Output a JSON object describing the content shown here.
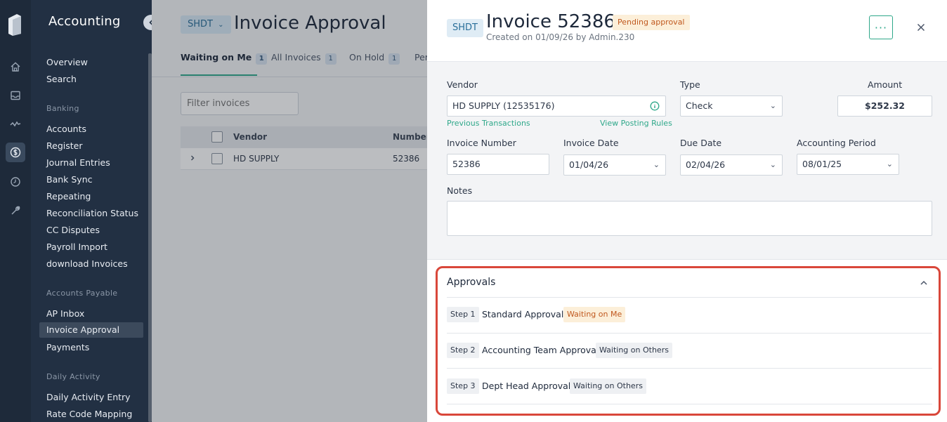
{
  "app": {
    "module_title": "Accounting"
  },
  "sidebar": {
    "items": [
      {
        "label": "Overview"
      },
      {
        "label": "Search"
      }
    ],
    "sections": [
      {
        "title": "Banking",
        "items": [
          "Accounts",
          "Register",
          "Journal Entries",
          "Bank Sync",
          "Repeating",
          "Reconciliation Status",
          "CC Disputes",
          "Payroll Import",
          "download Invoices"
        ]
      },
      {
        "title": "Accounts Payable",
        "items": [
          "AP Inbox",
          "Invoice Approval",
          "Payments"
        ]
      },
      {
        "title": "Daily Activity",
        "items": [
          "Daily Activity Entry",
          "Rate Code Mapping"
        ]
      }
    ],
    "active_item": "Invoice Approval"
  },
  "main": {
    "entity": "SHDT",
    "title": "Invoice Approval",
    "tabs": [
      {
        "label": "Waiting on Me",
        "count": "1"
      },
      {
        "label": "All Invoices",
        "count": "1"
      },
      {
        "label": "On Hold",
        "count": "1"
      },
      {
        "label": "Per",
        "count": ""
      }
    ],
    "filter_placeholder": "Filter invoices",
    "table": {
      "headers": [
        "Vendor",
        "Number"
      ],
      "rows": [
        {
          "vendor": "HD SUPPLY",
          "number": "52386"
        }
      ]
    }
  },
  "drawer": {
    "entity": "SHDT",
    "title": "Invoice 52386",
    "status": "Pending approval",
    "subtitle": "Created on 01/09/26 by Admin.230",
    "more_label": "···",
    "form": {
      "vendor_label": "Vendor",
      "vendor_value": "HD SUPPLY (12535176)",
      "previous_transactions": "Previous Transactions",
      "view_posting_rules": "View Posting Rules",
      "type_label": "Type",
      "type_value": "Check",
      "amount_label": "Amount",
      "amount_value": "$252.32",
      "invoice_number_label": "Invoice Number",
      "invoice_number_value": "52386",
      "invoice_date_label": "Invoice Date",
      "invoice_date_value": "01/04/26",
      "due_date_label": "Due Date",
      "due_date_value": "02/04/26",
      "accounting_period_label": "Accounting Period",
      "accounting_period_value": "08/01/25",
      "notes_label": "Notes",
      "notes_value": ""
    },
    "approvals": {
      "title": "Approvals",
      "steps": [
        {
          "step": "Step 1",
          "name": "Standard Approval",
          "status": "Waiting on Me"
        },
        {
          "step": "Step 2",
          "name": "Accounting Team Approval",
          "status": "Waiting on Others"
        },
        {
          "step": "Step 3",
          "name": "Dept Head Approval",
          "status": "Waiting on Others"
        }
      ]
    }
  },
  "colors": {
    "accent": "#2fa88a",
    "sidebar_bg": "#223043",
    "pending_text": "#c0581e",
    "pending_bg": "#fcefd9",
    "highlight": "#d9473a"
  }
}
